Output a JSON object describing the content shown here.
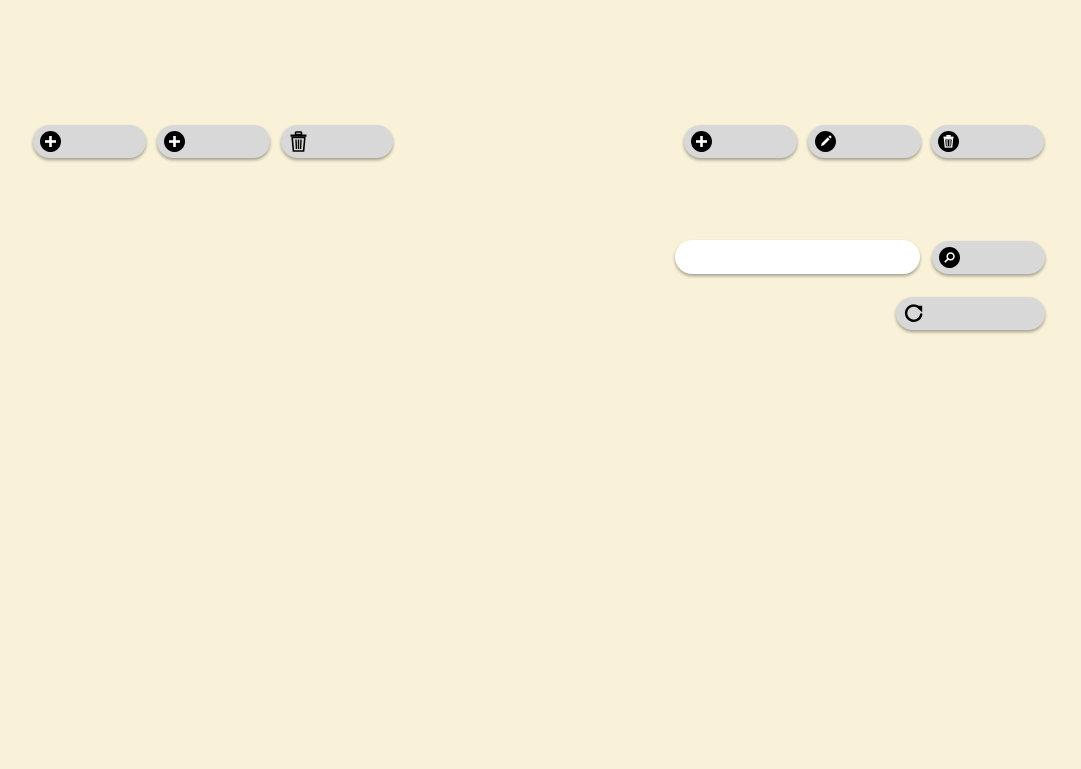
{
  "left_toolbar": {
    "add_button_1": {
      "icon": "plus-circle-icon",
      "label": ""
    },
    "add_button_2": {
      "icon": "plus-circle-icon",
      "label": ""
    },
    "delete_button": {
      "icon": "trash-icon",
      "label": ""
    }
  },
  "right_toolbar": {
    "add_button": {
      "icon": "plus-circle-icon",
      "label": ""
    },
    "edit_button": {
      "icon": "pencil-circle-icon",
      "label": ""
    },
    "delete_button": {
      "icon": "trash-circle-icon",
      "label": ""
    }
  },
  "search": {
    "value": "",
    "placeholder": "",
    "button": {
      "icon": "search-circle-icon",
      "label": ""
    }
  },
  "refresh_button": {
    "icon": "refresh-icon",
    "label": ""
  },
  "colors": {
    "background": "#f9f2d8",
    "button": "#d8d8d8",
    "input": "#ffffff",
    "icon": "#000000"
  }
}
